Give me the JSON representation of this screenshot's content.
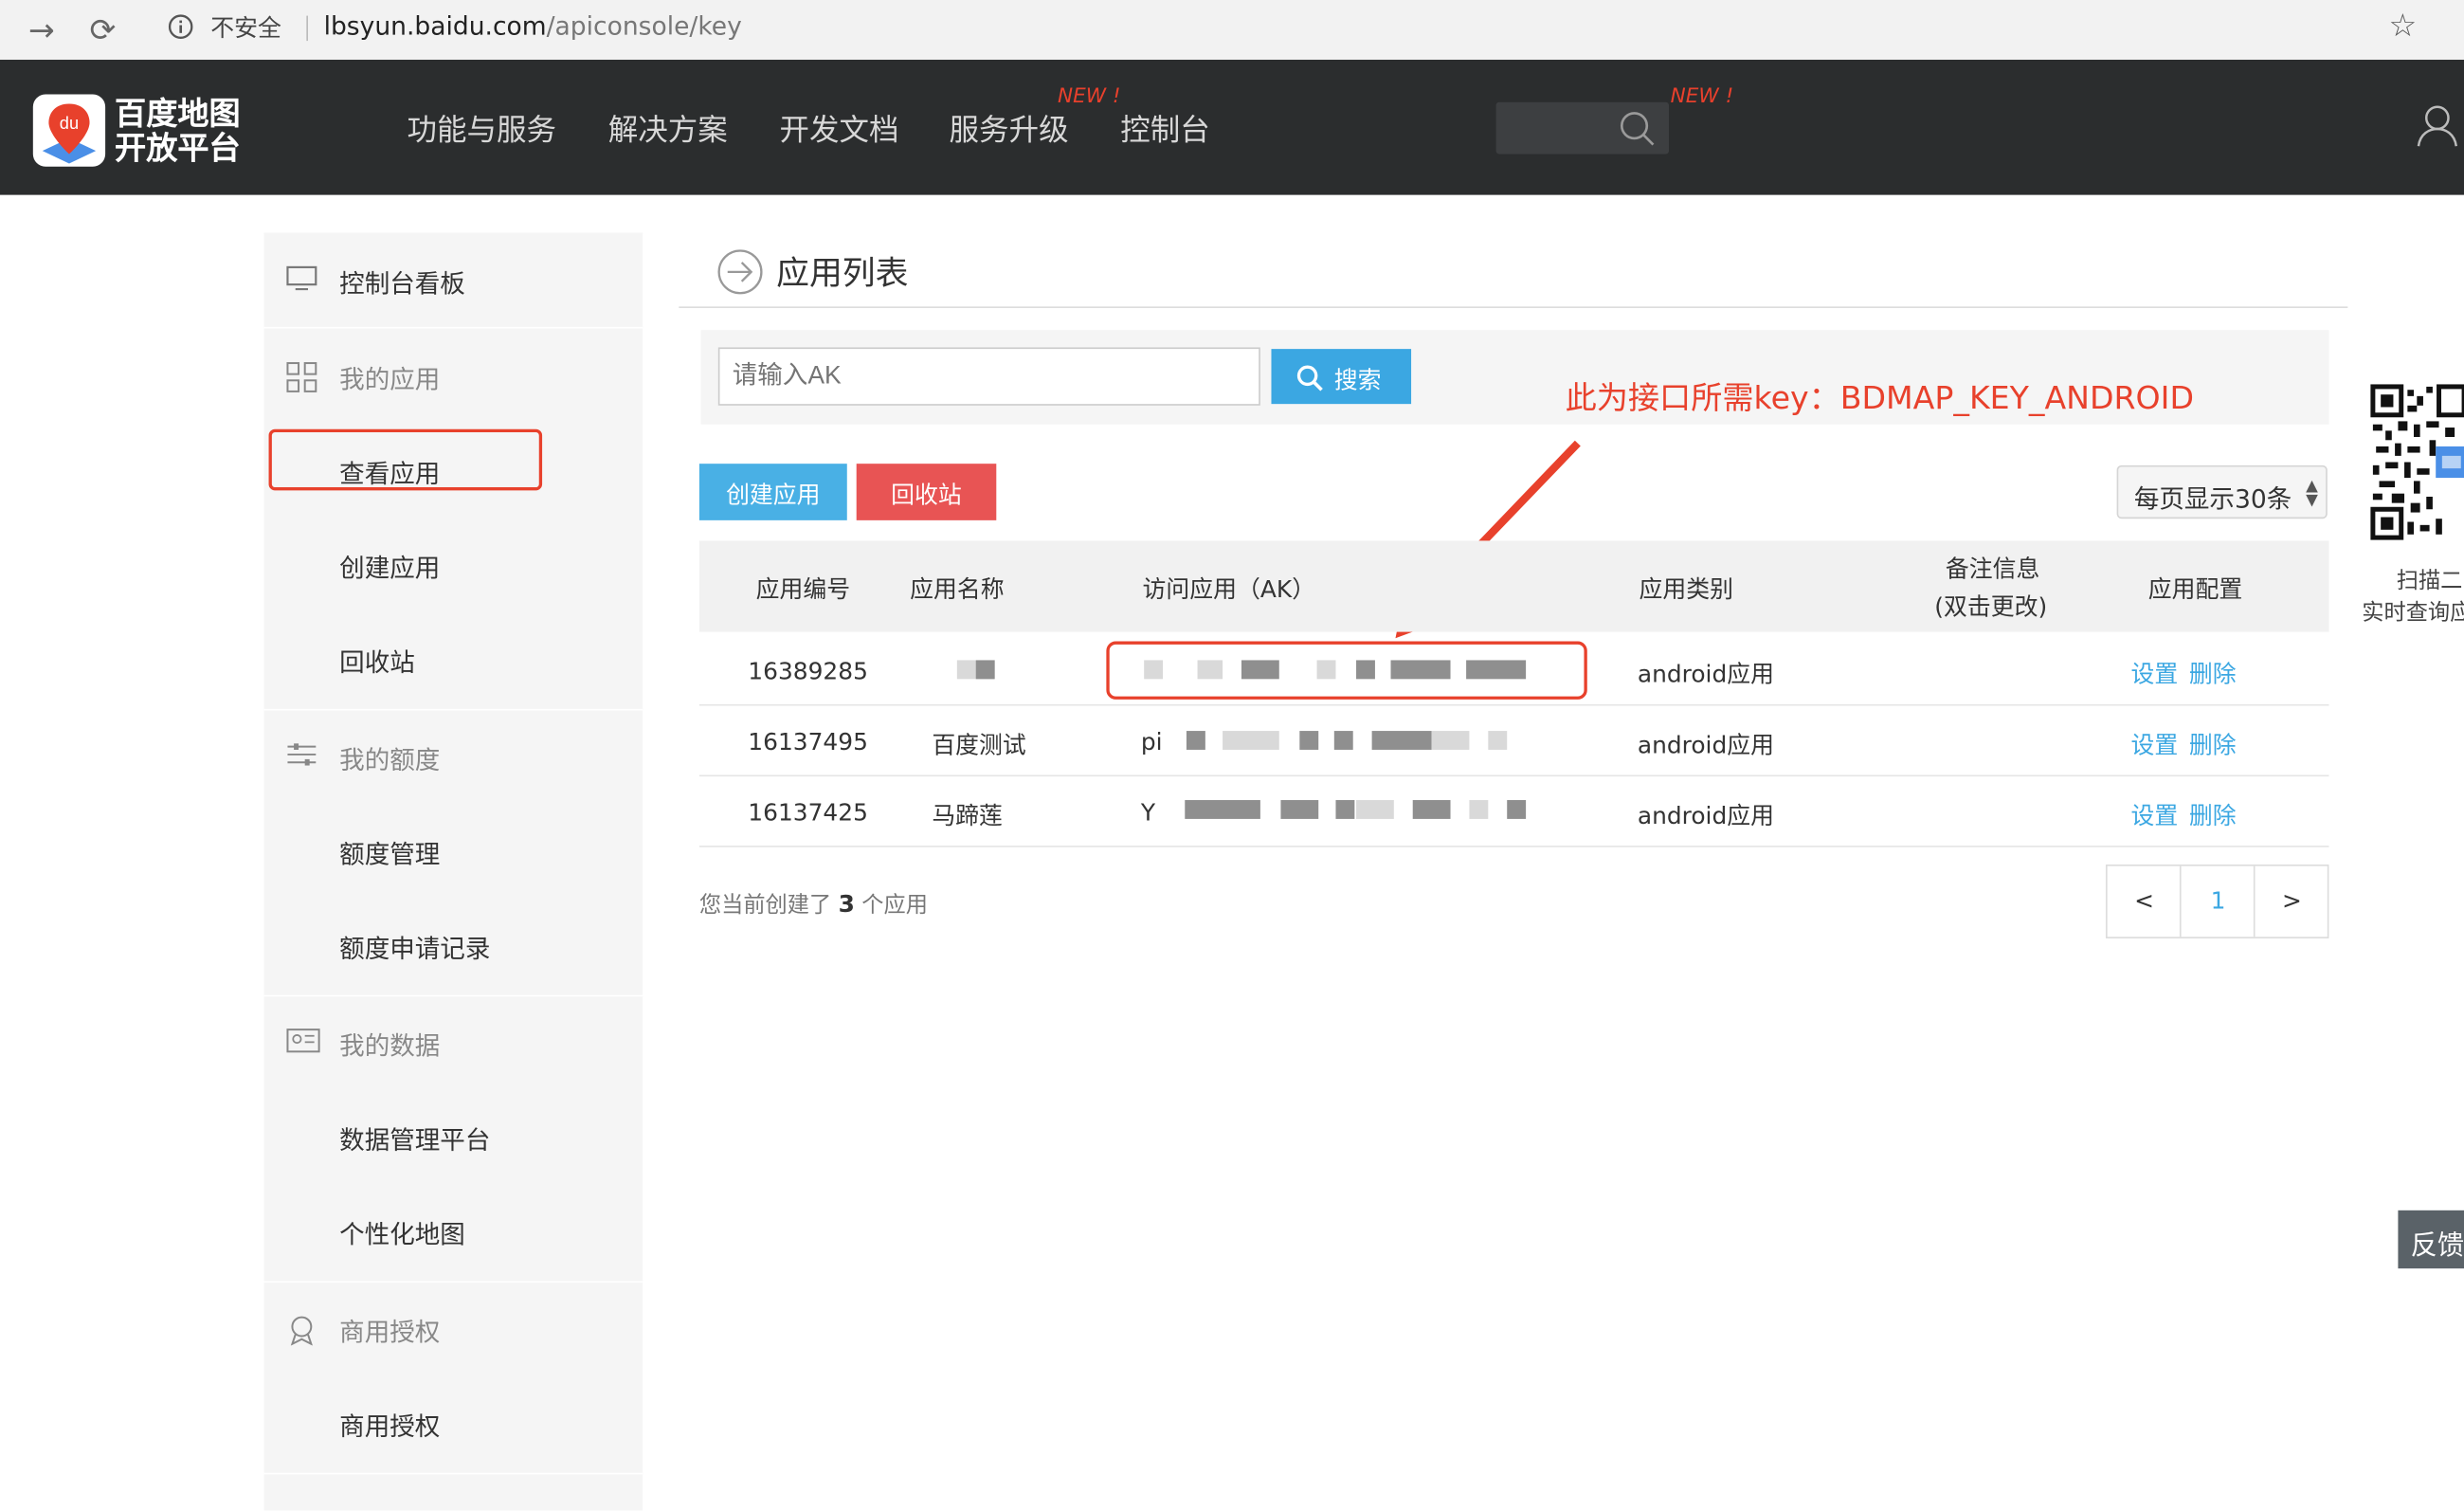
{
  "browser": {
    "insecure_label": "不安全",
    "url_host": "lbsyun.baidu.com",
    "url_path": "/apiconsole/key"
  },
  "header": {
    "logo_line1": "百度地图",
    "logo_line2": "开放平台",
    "logo_mark": "du",
    "nav": [
      "功能与服务",
      "解决方案",
      "开发文档",
      "服务升级",
      "控制台"
    ],
    "new_badge": "NEW !"
  },
  "sidebar": {
    "dashboard": "控制台看板",
    "my_apps": "我的应用",
    "view_apps": "查看应用",
    "create_app": "创建应用",
    "recycle": "回收站",
    "my_quota": "我的额度",
    "quota_manage": "额度管理",
    "quota_records": "额度申请记录",
    "my_data": "我的数据",
    "data_platform": "数据管理平台",
    "custom_map": "个性化地图",
    "commercial": "商用授权",
    "commercial_item": "商用授权"
  },
  "main": {
    "title": "应用列表",
    "search_placeholder": "请输入AK",
    "search_button": "搜索",
    "annotation": "此为接口所需key：BDMAP_KEY_ANDROID",
    "create_button": "创建应用",
    "recycle_button": "回收站",
    "per_page": "每页显示30条",
    "columns": [
      "应用编号",
      "应用名称",
      "访问应用（AK）",
      "应用类别",
      "备注信息",
      "(双击更改)",
      "应用配置"
    ],
    "rows": [
      {
        "id": "16389285",
        "name": "",
        "ak_prefix": "",
        "category": "android应用",
        "remark": "",
        "action_settings": "设置",
        "action_delete": "删除"
      },
      {
        "id": "16137495",
        "name": "百度测试",
        "ak_prefix": "pi",
        "category": "android应用",
        "remark": "",
        "action_settings": "设置",
        "action_delete": "删除"
      },
      {
        "id": "16137425",
        "name": "马蹄莲",
        "ak_prefix": "Y",
        "category": "android应用",
        "remark": "",
        "action_settings": "设置",
        "action_delete": "删除"
      }
    ],
    "count_prefix": "您当前创建了",
    "count_value": "3",
    "count_suffix": "个应用",
    "pager": {
      "prev": "<",
      "current": "1",
      "next": ">"
    }
  },
  "side_float": {
    "qr_caption_1": "扫描二",
    "qr_caption_2": "实时查询应",
    "feedback": "反馈"
  },
  "colors": {
    "accent": "#3ba7e2",
    "danger": "#e85454",
    "annotation": "#e8412c",
    "header_bg": "#2b2d2e"
  }
}
